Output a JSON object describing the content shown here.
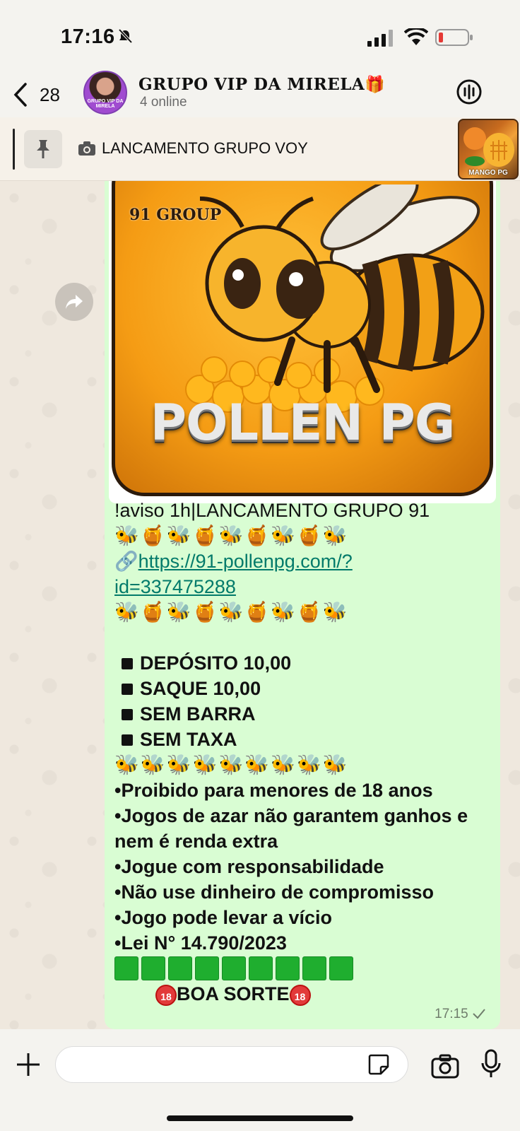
{
  "status_bar": {
    "time": "17:16"
  },
  "header": {
    "back_count": "28",
    "title": "GRUPO VIP DA MIRELA🎁",
    "subtitle": "4 online",
    "avatar_text": "GRUPO VIP DA MIRELA"
  },
  "pinned": {
    "text": "LANCAMENTO GRUPO VOY",
    "thumb_label": "MANGO PG"
  },
  "message": {
    "image_group_label": "91 GROUP",
    "image_title": "POLLEN PG",
    "line1": "!aviso 1h|LANCAMENTO GRUPO 91",
    "emoji_row1": "🐝🍯🐝🍯🐝🍯🐝🍯🐝",
    "link_line1": "https://91-pollenpg.com/?",
    "link_line2": "id=337475288",
    "emoji_row2": "🐝🍯🐝🍯🐝🍯🐝🍯🐝",
    "features": [
      "DEPÓSITO 10,00",
      "SAQUE 10,00",
      "SEM BARRA",
      "SEM TAXA"
    ],
    "emoji_row3": "🐝🐝🐝🐝🐝🐝🐝🐝🐝",
    "warnings": [
      "•Proibido para menores de 18 anos",
      "•Jogos de azar não garantem ganhos e",
      "nem é renda extra",
      "•Jogue com responsabilidade",
      "•Não use dinheiro de compromisso",
      "•Jogo pode levar a vício",
      "•Lei N° 14.790/2023"
    ],
    "green_squares": 9,
    "closing": "BOA SORTE",
    "badge_18": "18",
    "time": "17:15"
  },
  "colors": {
    "bubble": "#d9fdd3",
    "link": "#027a6a",
    "green_square": "#1fae2f"
  }
}
